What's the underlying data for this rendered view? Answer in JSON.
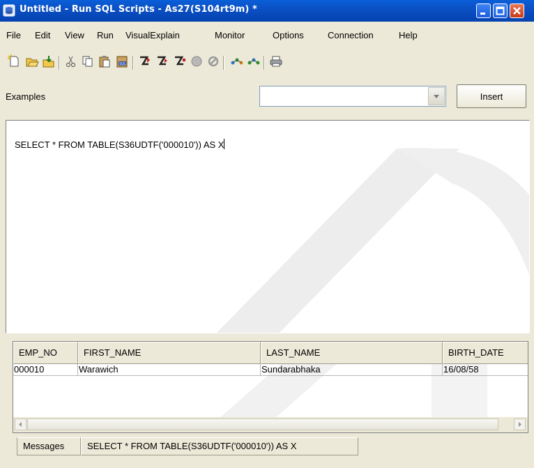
{
  "window": {
    "title": "Untitled - Run SQL Scripts - As27(S104rt9m) *"
  },
  "menu": [
    {
      "label": "File"
    },
    {
      "label": "Edit"
    },
    {
      "label": "View"
    },
    {
      "label": "Run"
    },
    {
      "label": "VisualExplain"
    },
    {
      "label": "Monitor"
    },
    {
      "label": "Options"
    },
    {
      "label": "Connection"
    },
    {
      "label": "Help"
    }
  ],
  "toolbar": {
    "icons": [
      "new-icon",
      "open-icon",
      "save-icon",
      "cut-icon",
      "copy-icon",
      "paste-icon",
      "insert-sql-icon",
      "run-all-icon",
      "run-from-selected-icon",
      "run-selected-icon",
      "stop-icon",
      "cancel-icon",
      "explain-icon",
      "run-and-explain-icon",
      "print-icon"
    ]
  },
  "examples": {
    "label": "Examples",
    "selected": "",
    "insert_label": "Insert"
  },
  "editor": {
    "text": "SELECT * FROM TABLE(S36UDTF('000010')) AS X"
  },
  "results": {
    "columns": [
      "EMP_NO",
      "FIRST_NAME",
      "LAST_NAME",
      "BIRTH_DATE"
    ],
    "rows": [
      [
        "000010",
        "Warawich",
        "Sundarabhaka",
        "16/08/58"
      ]
    ]
  },
  "tabs": [
    {
      "label": "Messages"
    },
    {
      "label": "SELECT * FROM TABLE(S36UDTF('000010')) AS X"
    }
  ],
  "colors": {
    "titlebar": "#0b50c4",
    "window_bg": "#ece9d8"
  }
}
